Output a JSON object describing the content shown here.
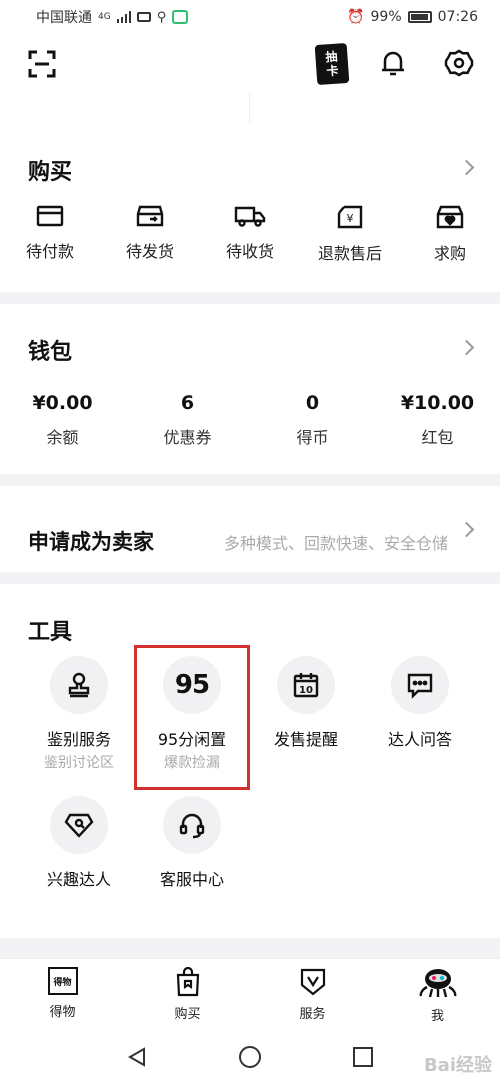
{
  "status_bar": {
    "carrier": "中国联通",
    "network": "4G",
    "battery": "99%",
    "time": "07:26"
  },
  "header": {
    "card_button_label_top": "抽",
    "card_button_label_bottom": "卡"
  },
  "buy": {
    "title": "购买",
    "items": [
      {
        "label": "待付款",
        "icon": "wallet-card-icon"
      },
      {
        "label": "待发货",
        "icon": "box-icon"
      },
      {
        "label": "待收货",
        "icon": "truck-icon"
      },
      {
        "label": "退款售后",
        "icon": "refund-icon"
      },
      {
        "label": "求购",
        "icon": "heart-box-icon"
      }
    ]
  },
  "wallet": {
    "title": "钱包",
    "items": [
      {
        "value": "¥0.00",
        "label": "余额"
      },
      {
        "value": "6",
        "label": "优惠券"
      },
      {
        "value": "0",
        "label": "得币"
      },
      {
        "value": "¥10.00",
        "label": "红包"
      }
    ]
  },
  "seller": {
    "title": "申请成为卖家",
    "hint": "多种模式、回款快速、安全仓储"
  },
  "tools": {
    "title": "工具",
    "items": [
      {
        "label": "鉴别服务",
        "sub": "鉴别讨论区",
        "icon": "stamp-icon"
      },
      {
        "label": "95分闲置",
        "sub": "爆款捡漏",
        "icon": "95-logo-icon",
        "glyph": "95"
      },
      {
        "label": "发售提醒",
        "sub": "",
        "icon": "calendar-icon",
        "glyph": "10"
      },
      {
        "label": "达人问答",
        "sub": "",
        "icon": "chat-icon"
      },
      {
        "label": "兴趣达人",
        "sub": "",
        "icon": "diamond-icon"
      },
      {
        "label": "客服中心",
        "sub": "",
        "icon": "headset-icon"
      }
    ],
    "highlight_color": "#d32f2f"
  },
  "tab_bar": {
    "items": [
      {
        "label": "得物",
        "icon": "dewu-logo-icon",
        "glyph": "得物"
      },
      {
        "label": "购买",
        "icon": "shopping-bag-icon"
      },
      {
        "label": "服务",
        "icon": "shield-v-icon"
      },
      {
        "label": "我",
        "icon": "avatar-icon"
      }
    ]
  },
  "watermark": "Bai经验"
}
